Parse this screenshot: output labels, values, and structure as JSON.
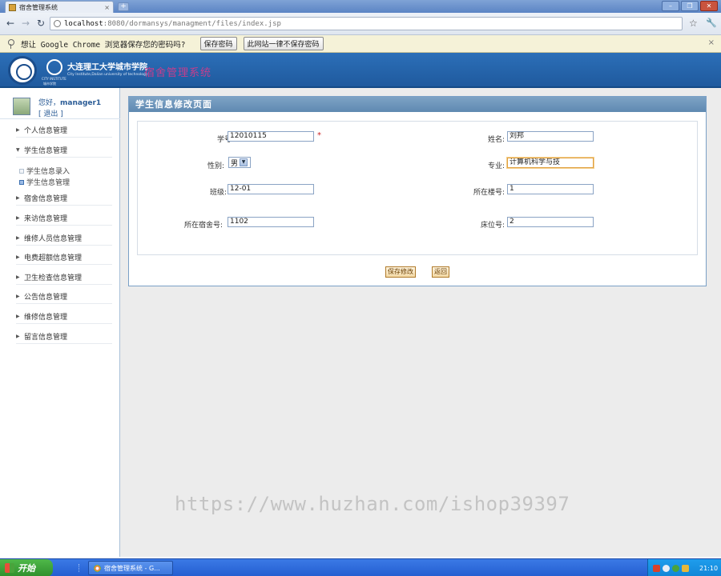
{
  "browser": {
    "tab_title": "宿舍管理系统",
    "tab_close": "×",
    "new_tab": "+",
    "url_host": "localhost",
    "url_path": ":8080/dormansys/managment/files/index.jsp",
    "min": "–",
    "max": "❐",
    "close": "✕"
  },
  "password_bar": {
    "prompt": "想让 Google Chrome 浏览器保存您的密码吗?",
    "save_label": "保存密码",
    "never_label": "此网站一律不保存密码",
    "close": "×"
  },
  "header": {
    "school_cn": "大连理工大学城市学院",
    "school_en": "City Institute,Dalian university of technology",
    "logo_sub": "CITY INSTITUTE",
    "logo_sub2": "城市学院",
    "system_name": "宿舍管理系统"
  },
  "user": {
    "greeting": "您好，",
    "name": "manager1",
    "logout": "[ 退出 ]"
  },
  "sidebar": {
    "items": [
      {
        "label": "个人信息管理",
        "arrow": "▶"
      },
      {
        "label": "学生信息管理",
        "arrow": "▼"
      },
      {
        "label": "宿舍信息管理",
        "arrow": "▶"
      },
      {
        "label": "来访信息管理",
        "arrow": "▶"
      },
      {
        "label": "维修人员信息管理",
        "arrow": "▶"
      },
      {
        "label": "电费超额信息管理",
        "arrow": "▶"
      },
      {
        "label": "卫生检查信息管理",
        "arrow": "▶"
      },
      {
        "label": "公告信息管理",
        "arrow": "▶"
      },
      {
        "label": "维修信息管理",
        "arrow": "▶"
      },
      {
        "label": "留言信息管理",
        "arrow": "▶"
      }
    ],
    "sub_items": [
      {
        "label": "学生信息录入"
      },
      {
        "label": "学生信息管理"
      }
    ]
  },
  "panel": {
    "title": "学生信息修改页面"
  },
  "form": {
    "student_no_label": "学号:",
    "student_no": "12010115",
    "required_mark": "*",
    "name_label": "姓名:",
    "name": "刘邦",
    "gender_label": "性别:",
    "gender": "男",
    "major_label": "专业:",
    "major": "计算机科学与技",
    "class_label": "班级:",
    "class": "12-01",
    "building_label": "所在楼号:",
    "building": "1",
    "dorm_label": "所在宿舍号:",
    "dorm": "1102",
    "bed_label": "床位号:",
    "bed": "2",
    "save_label": "保存修改",
    "back_label": "返回"
  },
  "watermark": "https://www.huzhan.com/ishop39397",
  "taskbar": {
    "start_label": "开始",
    "task_label": "宿舍管理系统 - G...",
    "clock": "21:10"
  }
}
